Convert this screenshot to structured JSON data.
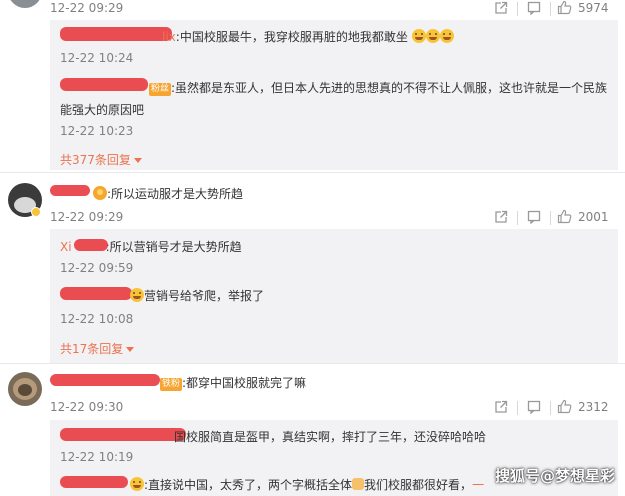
{
  "colors": {
    "accent": "#eb7350",
    "redaction": "#e8353a",
    "subbg": "#f2f2f5"
  },
  "c0": {
    "time": "12-22 09:29",
    "likes": "5974"
  },
  "c0r1": {
    "name_tail": "lix",
    "text": ":中国校服最牛，我穿校服再脏的地我都敢坐",
    "time": "12-22 10:24"
  },
  "c0r2": {
    "badge": "粉丝",
    "text": ":虽然都是东亚人，但日本人先进的思想真的不得不让人佩服，这也许就是一个民族",
    "text2": "能强大的原因吧",
    "time": "12-22 10:23"
  },
  "c0_more": "共377条回复",
  "c1": {
    "text": ":所以运动服才是大势所趋",
    "time": "12-22 09:29",
    "likes": "2001"
  },
  "c1r1": {
    "name": "Xi",
    "text": ":所以营销号才是大势所趋",
    "time": "12-22 09:59"
  },
  "c1r2": {
    "text": "营销号给爷爬，举报了",
    "time": "12-22 10:08"
  },
  "c1_more": "共17条回复",
  "c2": {
    "badge": "铁粉",
    "text": ":都穿中国校服就完了嘛",
    "time": "12-22 09:30",
    "likes": "2312"
  },
  "c2r1": {
    "text": "国校服简直是盔甲，真结实啊，摔打了三年，还没碎哈哈哈",
    "time": "12-22 10:19"
  },
  "c2r2": {
    "text": ":直接说中国，太秀了，两个字概括全体",
    "text2": "我们校服都很好看，",
    "name_tail": "一"
  },
  "watermark": "搜狐号@梦想星彩"
}
